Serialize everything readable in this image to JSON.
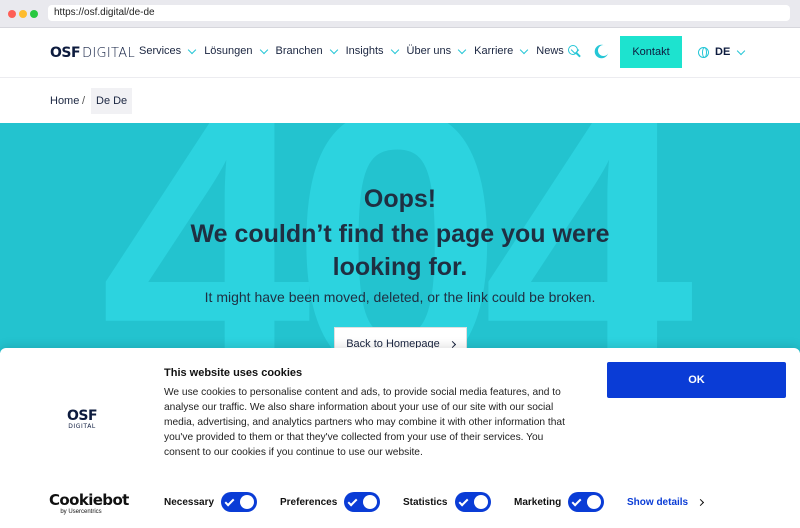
{
  "browser": {
    "url": "https://osf.digital/de-de"
  },
  "header": {
    "logo_primary": "OSF",
    "logo_secondary": "DIGITAL",
    "nav": [
      "Services",
      "Lösungen",
      "Branchen",
      "Insights",
      "Über uns",
      "Karriere",
      "News"
    ],
    "search_icon": "search-icon",
    "theme_icon": "moon-icon",
    "contact_label": "Kontakt",
    "language": "DE",
    "accent_color": "#25c6d6",
    "contact_color": "#1de3cf"
  },
  "breadcrumb": {
    "home": "Home",
    "separator": "/",
    "current": "De De"
  },
  "hero": {
    "background_text": "404",
    "title": "Oops!",
    "headline": "We couldn’t find the page you were looking for.",
    "subtitle": "It might have been moved, deleted, or the link could be broken.",
    "button_label": "Back to Homepage",
    "background_color": "#23c3cf"
  },
  "cookie": {
    "logo_primary": "OSF",
    "logo_secondary": "DIGITAL",
    "title": "This website uses cookies",
    "text": "We use cookies to personalise content and ads, to provide social media features, and to analyse our traffic. We also share information about your use of our site with our social media, advertising, and analytics partners who may combine it with other information that you've provided to them or that they've collected from your use of their services. You consent to our cookies if you continue to use our website.",
    "ok_label": "OK",
    "brand": "Cookiebot",
    "brand_by": "by Usercentrics",
    "toggles": [
      {
        "label": "Necessary",
        "on": true
      },
      {
        "label": "Preferences",
        "on": true
      },
      {
        "label": "Statistics",
        "on": true
      },
      {
        "label": "Marketing",
        "on": true
      }
    ],
    "details_label": "Show details",
    "button_color": "#0a3cd6"
  }
}
